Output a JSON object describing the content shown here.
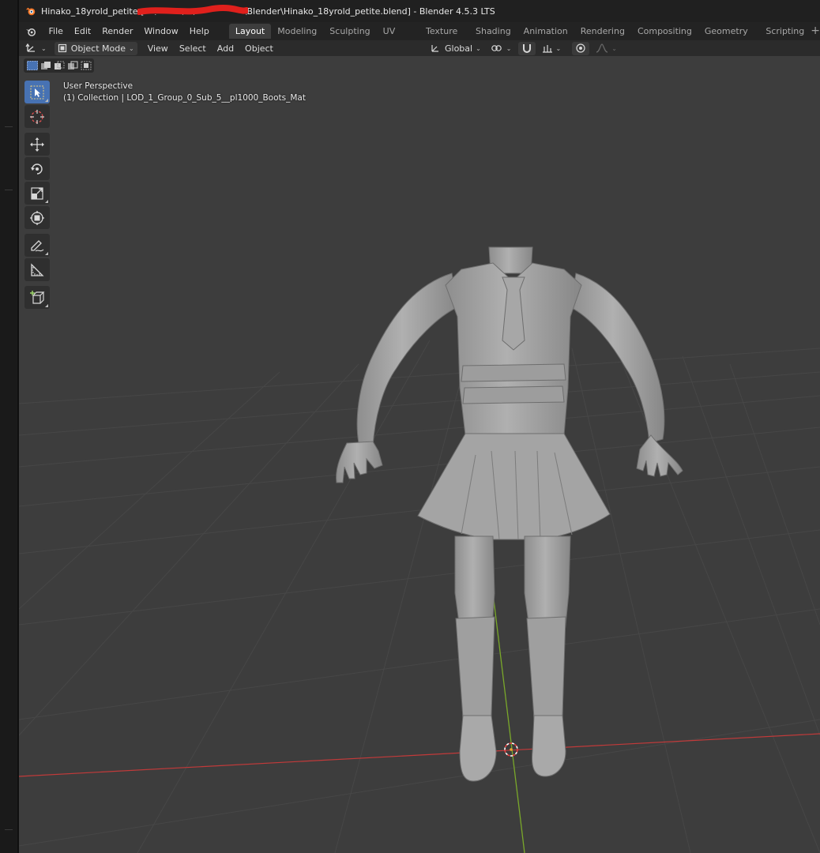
{
  "window": {
    "title": "Hinako_18yrold_petite [C:\\Users\\...\\Documents\\Blender\\Hinako_18yrold_petite.blend] - Blender 4.5.3 LTS"
  },
  "menus": [
    "File",
    "Edit",
    "Render",
    "Window",
    "Help"
  ],
  "workspace_tabs": [
    "Layout",
    "Modeling",
    "Sculpting",
    "UV Editing",
    "Texture Paint",
    "Shading",
    "Animation",
    "Rendering",
    "Compositing",
    "Geometry Nodes",
    "Scripting"
  ],
  "active_workspace": "Layout",
  "header": {
    "mode": "Object Mode",
    "menus": [
      "View",
      "Select",
      "Add",
      "Object"
    ],
    "transform_orientation": "Global"
  },
  "viewport": {
    "perspective": "User Perspective",
    "collection_info": "(1) Collection | LOD_1_Group_0_Sub_5__pl1000_Boots_Mat"
  },
  "tools": [
    "select-box",
    "cursor",
    "move",
    "rotate",
    "scale",
    "transform",
    "annotate",
    "measure",
    "add-cube"
  ],
  "colors": {
    "viewport_bg": "#3d3d3d",
    "grid": "#474747",
    "x_axis": "#c23a3a",
    "y_axis": "#7aa82a",
    "active_tool": "#4772b3",
    "redaction": "#e0201c"
  }
}
